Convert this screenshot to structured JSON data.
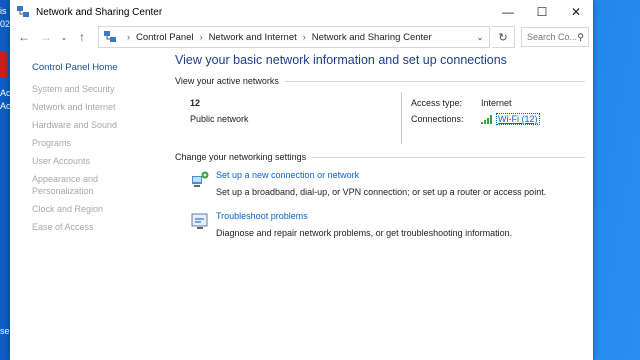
{
  "window": {
    "title": "Network and Sharing Center"
  },
  "desktop": {
    "left_texts": [
      "is",
      "02",
      "Ac",
      "Ac",
      "se"
    ]
  },
  "addressbar": {
    "crumbs": [
      "Control Panel",
      "Network and Internet",
      "Network and Sharing Center"
    ],
    "search_placeholder": "Search Co..."
  },
  "sidebar": {
    "home": "Control Panel Home",
    "items": [
      "System and Security",
      "Network and Internet",
      "Hardware and Sound",
      "Programs",
      "User Accounts",
      "Appearance and Personalization",
      "Clock and Region",
      "Ease of Access"
    ]
  },
  "main": {
    "heading": "View your basic network information and set up connections",
    "active_header": "View your active networks",
    "network": {
      "name": "12",
      "type": "Public network",
      "access_label": "Access type:",
      "access_value": "Internet",
      "connections_label": "Connections:",
      "connections_value": "Wi-Fi (12)"
    },
    "settings_header": "Change your networking settings",
    "settings": [
      {
        "link": "Set up a new connection or network",
        "desc": "Set up a broadband, dial-up, or VPN connection; or set up a router or access point."
      },
      {
        "link": "Troubleshoot problems",
        "desc": "Diagnose and repair network problems, or get troubleshooting information."
      }
    ]
  },
  "colors": {
    "heading": "#1c3f87",
    "link": "#0b63ce",
    "sidebar_disabled": "#a8a8a8"
  }
}
